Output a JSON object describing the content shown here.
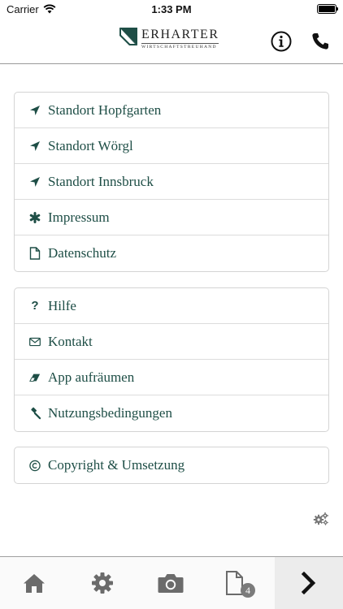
{
  "status_bar": {
    "carrier": "Carrier",
    "time": "1:33 PM"
  },
  "header": {
    "logo_name": "ERHARTER",
    "logo_subtitle": "WIRTSCHAFTSTREUHAND",
    "info_icon": "info-circle-icon",
    "phone_icon": "phone-icon"
  },
  "menu": {
    "group1": [
      {
        "label": "Standort Hopfgarten",
        "icon": "location-arrow-icon"
      },
      {
        "label": "Standort Wörgl",
        "icon": "location-arrow-icon"
      },
      {
        "label": "Standort Innsbruck",
        "icon": "location-arrow-icon"
      },
      {
        "label": "Impressum",
        "icon": "asterisk-icon"
      },
      {
        "label": "Datenschutz",
        "icon": "document-icon"
      }
    ],
    "group2": [
      {
        "label": "Hilfe",
        "icon": "question-icon"
      },
      {
        "label": "Kontakt",
        "icon": "envelope-icon"
      },
      {
        "label": "App aufräumen",
        "icon": "eraser-icon"
      },
      {
        "label": "Nutzungsbedingungen",
        "icon": "gavel-icon"
      }
    ],
    "group3": [
      {
        "label": "Copyright & Umsetzung",
        "icon": "copyright-icon"
      }
    ]
  },
  "tabbar": {
    "tabs": [
      "home-icon",
      "settings-gear-icon",
      "camera-icon",
      "documents-icon",
      "chevron-right-icon"
    ],
    "documents_badge": "4"
  },
  "colors": {
    "accent": "#1e4e46",
    "icon_gray": "#6b6b6b"
  }
}
